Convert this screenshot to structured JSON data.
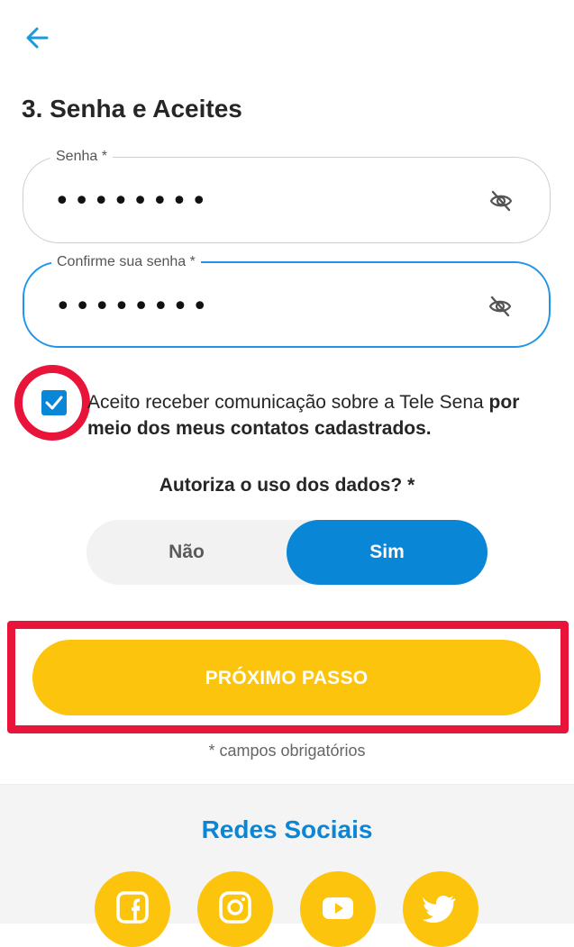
{
  "header": {
    "back_icon": "arrow-left-icon"
  },
  "step_title": "3. Senha e Aceites",
  "password": {
    "label": "Senha *",
    "value": "••••••••",
    "toggle_icon": "eye-off-icon"
  },
  "confirm": {
    "label": "Confirme sua senha *",
    "value": "••••••••",
    "toggle_icon": "eye-off-icon"
  },
  "consent": {
    "checked": true,
    "text_part1": "Aceito receber comunicação sobre a Tele Sena ",
    "text_part2": "por meio dos meus contatos cadastrados."
  },
  "data_authorization": {
    "question": "Autoriza o uso dos dados? *",
    "options": [
      "Não",
      "Sim"
    ],
    "selected": "Sim"
  },
  "next_button": "PRÓXIMO PASSO",
  "required_note": "* campos obrigatórios",
  "footer": {
    "title": "Redes Sociais",
    "icons": [
      "facebook-icon",
      "instagram-icon",
      "youtube-icon",
      "twitter-icon"
    ]
  },
  "colors": {
    "primary_blue": "#0a86d6",
    "accent_yellow": "#fdc40d",
    "highlight_red": "#e8143a"
  }
}
